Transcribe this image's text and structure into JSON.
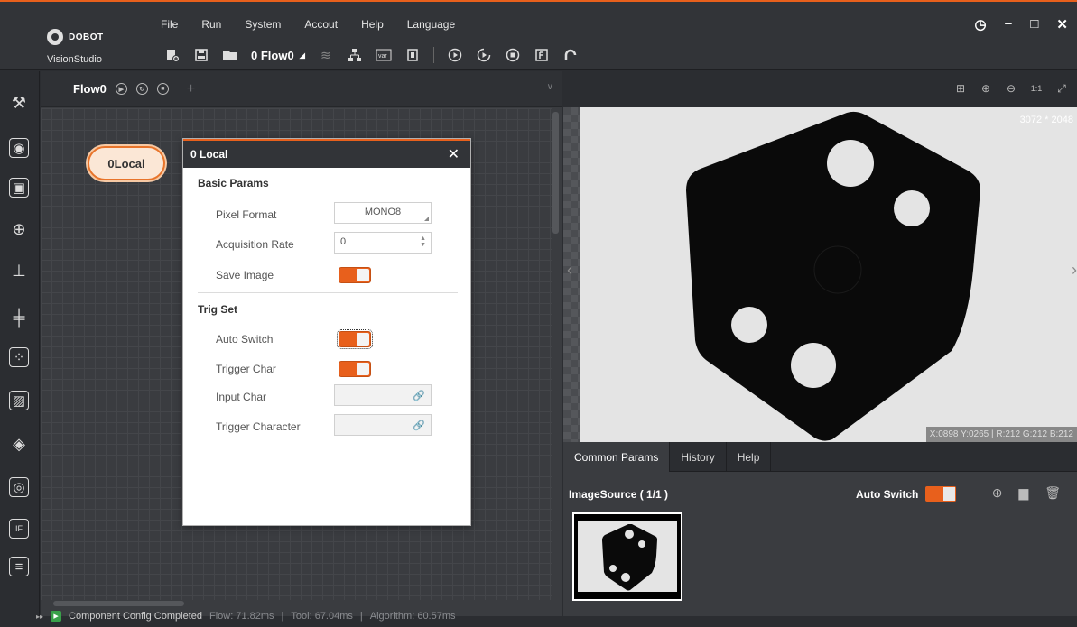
{
  "app": {
    "logo_text": "DOBOT",
    "logo_sub": "VisionStudio"
  },
  "menu": {
    "items": [
      "File",
      "Run",
      "System",
      "Accout",
      "Help",
      "Language"
    ]
  },
  "toolbar": {
    "flow_select": "0 Flow0",
    "icons": [
      "new-project-icon",
      "save-icon",
      "open-folder-icon",
      "layers-icon",
      "hierarchy-icon",
      "var-icon",
      "device-icon",
      "run-once-icon",
      "run-loop-icon",
      "stop-icon",
      "form-icon",
      "back-icon"
    ]
  },
  "window_controls": [
    "history-icon",
    "minimize-icon",
    "maximize-icon",
    "close-icon"
  ],
  "rail": {
    "icons": [
      "tools-icon",
      "camera-icon",
      "focus-icon",
      "target-icon",
      "measure-icon",
      "align-icon",
      "scatter-icon",
      "image-edit-icon",
      "fill-icon",
      "lens-icon",
      "if-icon",
      "logic-icon"
    ]
  },
  "flow": {
    "tab_label": "Flow0",
    "node_label": "0Local"
  },
  "dialog": {
    "title": "0 Local",
    "basic_params": "Basic Params",
    "pixel_format_label": "Pixel Format",
    "pixel_format_value": "MONO8",
    "acquisition_rate_label": "Acquisition Rate",
    "acquisition_rate_value": "0",
    "save_image_label": "Save Image",
    "trig_set": "Trig Set",
    "auto_switch_label": "Auto Switch",
    "trigger_char_label": "Trigger Char",
    "input_char_label": "Input Char",
    "trigger_character_label": "Trigger Character"
  },
  "status": {
    "message": "Component Config Completed",
    "flow_time": "Flow: 71.82ms",
    "tool_time": "Tool: 67.04ms",
    "algorithm_time": "Algorithm: 60.57ms"
  },
  "image": {
    "resolution": "3072 * 2048",
    "pixel_info": "X:0898 Y:0265 | R:212 G:212 B:212"
  },
  "params": {
    "tabs": [
      "Common Params",
      "History",
      "Help"
    ],
    "image_source": "ImageSource ( 1/1 )",
    "auto_switch": "Auto Switch"
  },
  "colors": {
    "accent": "#e8601c",
    "background": "#2b2d31",
    "panel": "#3a3c40"
  }
}
